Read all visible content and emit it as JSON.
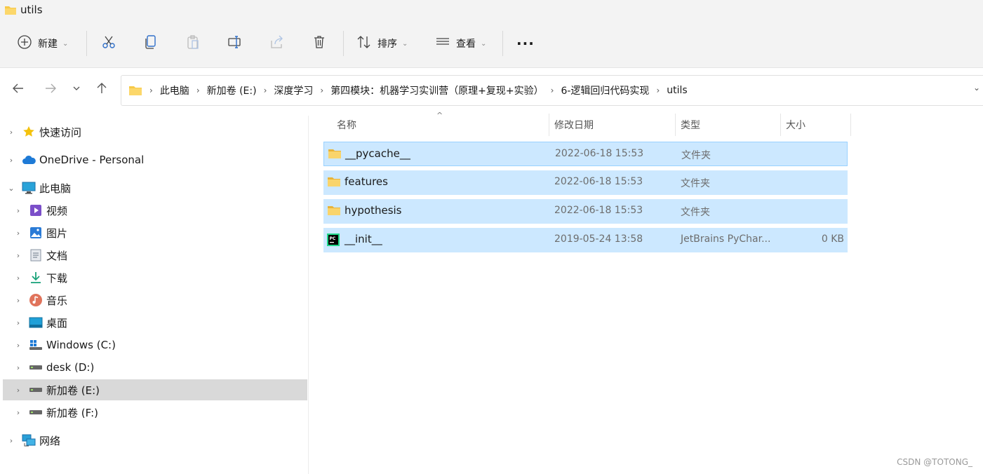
{
  "window": {
    "title": "utils"
  },
  "toolbar": {
    "new_label": "新建",
    "sort_label": "排序",
    "view_label": "查看",
    "more_label": "···"
  },
  "address": {
    "crumbs": [
      "此电脑",
      "新加卷 (E:)",
      "深度学习",
      "第四模块：机器学习实训营（原理+复现+实验）",
      "6-逻辑回归代码实现",
      "utils"
    ]
  },
  "sidebar": {
    "items": [
      {
        "label": "快速访问",
        "icon": "star-icon"
      },
      {
        "label": "OneDrive - Personal",
        "icon": "cloud-icon"
      },
      {
        "label": "此电脑",
        "icon": "monitor-icon"
      },
      {
        "label": "视频",
        "icon": "video-icon"
      },
      {
        "label": "图片",
        "icon": "picture-icon"
      },
      {
        "label": "文档",
        "icon": "document-icon"
      },
      {
        "label": "下载",
        "icon": "download-icon"
      },
      {
        "label": "音乐",
        "icon": "music-icon"
      },
      {
        "label": "桌面",
        "icon": "desktop-icon"
      },
      {
        "label": "Windows (C:)",
        "icon": "windows-drive-icon"
      },
      {
        "label": "desk (D:)",
        "icon": "drive-icon"
      },
      {
        "label": "新加卷 (E:)",
        "icon": "drive-icon"
      },
      {
        "label": "新加卷 (F:)",
        "icon": "drive-icon"
      },
      {
        "label": "网络",
        "icon": "network-icon"
      }
    ]
  },
  "columns": {
    "name": "名称",
    "modified": "修改日期",
    "type": "类型",
    "size": "大小"
  },
  "files": [
    {
      "name": "__pycache__",
      "modified": "2022-06-18 15:53",
      "type": "文件夹",
      "size": "",
      "icon": "folder-icon"
    },
    {
      "name": "features",
      "modified": "2022-06-18 15:53",
      "type": "文件夹",
      "size": "",
      "icon": "folder-icon"
    },
    {
      "name": "hypothesis",
      "modified": "2022-06-18 15:53",
      "type": "文件夹",
      "size": "",
      "icon": "folder-icon"
    },
    {
      "name": "__init__",
      "modified": "2019-05-24 13:58",
      "type": "JetBrains PyChar...",
      "size": "0 KB",
      "icon": "pycharm-file-icon"
    }
  ],
  "watermark": "CSDN @TOTONG_",
  "colors": {
    "selection": "#cce8ff",
    "selection_border": "#99d1ff",
    "sidebar_selected": "#d9d9d9",
    "folder": "#f7c948"
  }
}
